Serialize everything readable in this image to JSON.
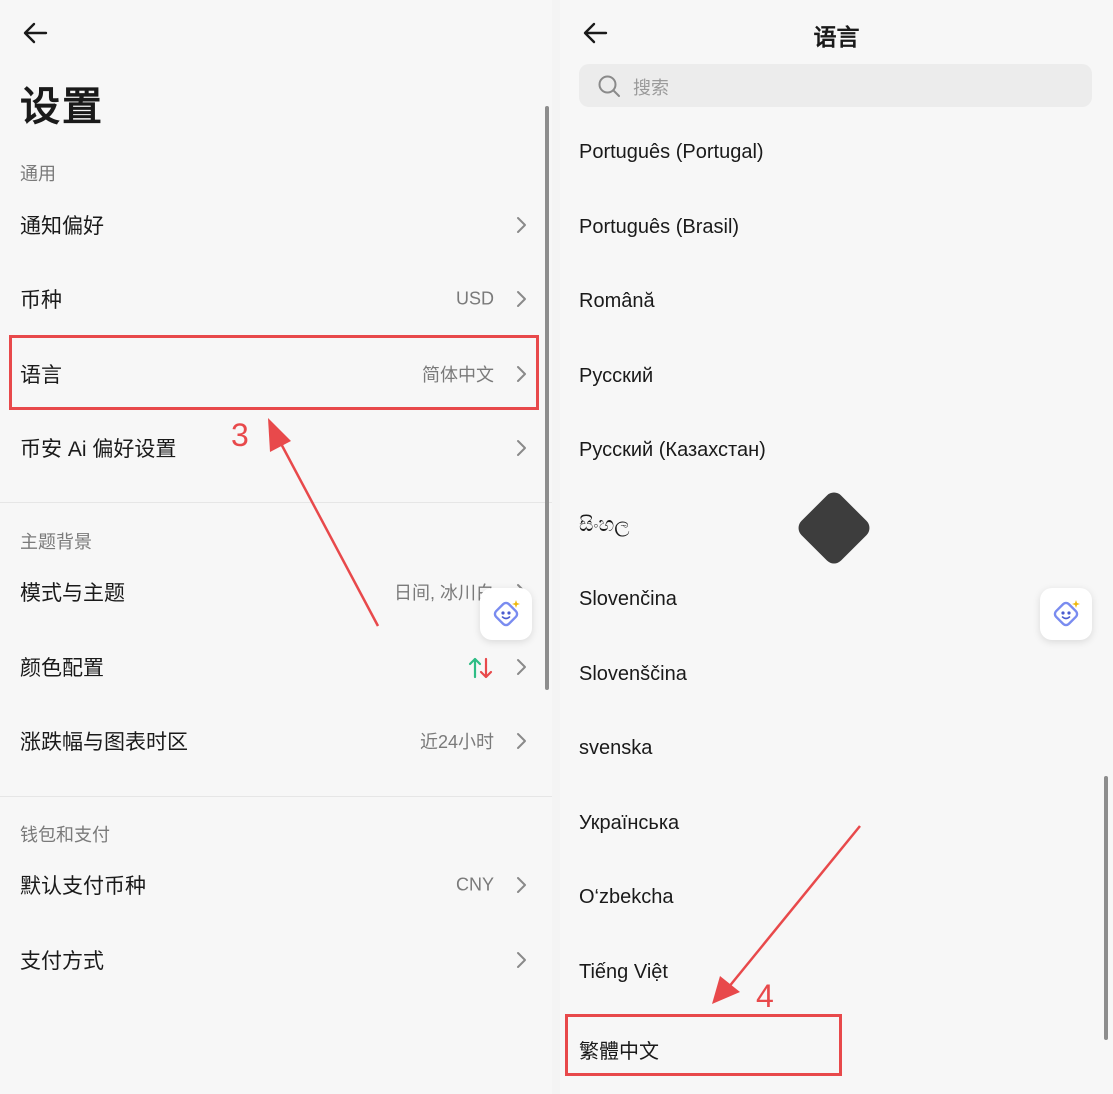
{
  "settings": {
    "title": "设置",
    "sections": {
      "general": "通用",
      "theme": "主题背景",
      "wallet": "钱包和支付"
    },
    "rows": {
      "notifications": {
        "label": "通知偏好",
        "value": ""
      },
      "currency": {
        "label": "币种",
        "value": "USD"
      },
      "language": {
        "label": "语言",
        "value": "简体中文"
      },
      "ai": {
        "label": "币安 Ai 偏好设置",
        "value": ""
      },
      "mode": {
        "label": "模式与主题",
        "value": "日间, 冰川白"
      },
      "color": {
        "label": "颜色配置",
        "value": ""
      },
      "timezone": {
        "label": "涨跌幅与图表时区",
        "value": "近24小时"
      },
      "default_pay": {
        "label": "默认支付币种",
        "value": "CNY"
      },
      "pay_method": {
        "label": "支付方式",
        "value": ""
      }
    },
    "colors": {
      "up": "#2ebd85",
      "down": "#e8494b"
    }
  },
  "language_page": {
    "title": "语言",
    "search_placeholder": "搜索",
    "languages": [
      "Português (Portugal)",
      "Português (Brasil)",
      "Română",
      "Русский",
      "Русский (Казахстан)",
      "සිංහල",
      "Slovenčina",
      "Slovenščina",
      "svenska",
      "Українська",
      "O‘zbekcha",
      "Tiếng Việt",
      "繁體中文"
    ]
  },
  "annotations": {
    "step3": "3",
    "step4": "4",
    "color": "#e8494b"
  }
}
